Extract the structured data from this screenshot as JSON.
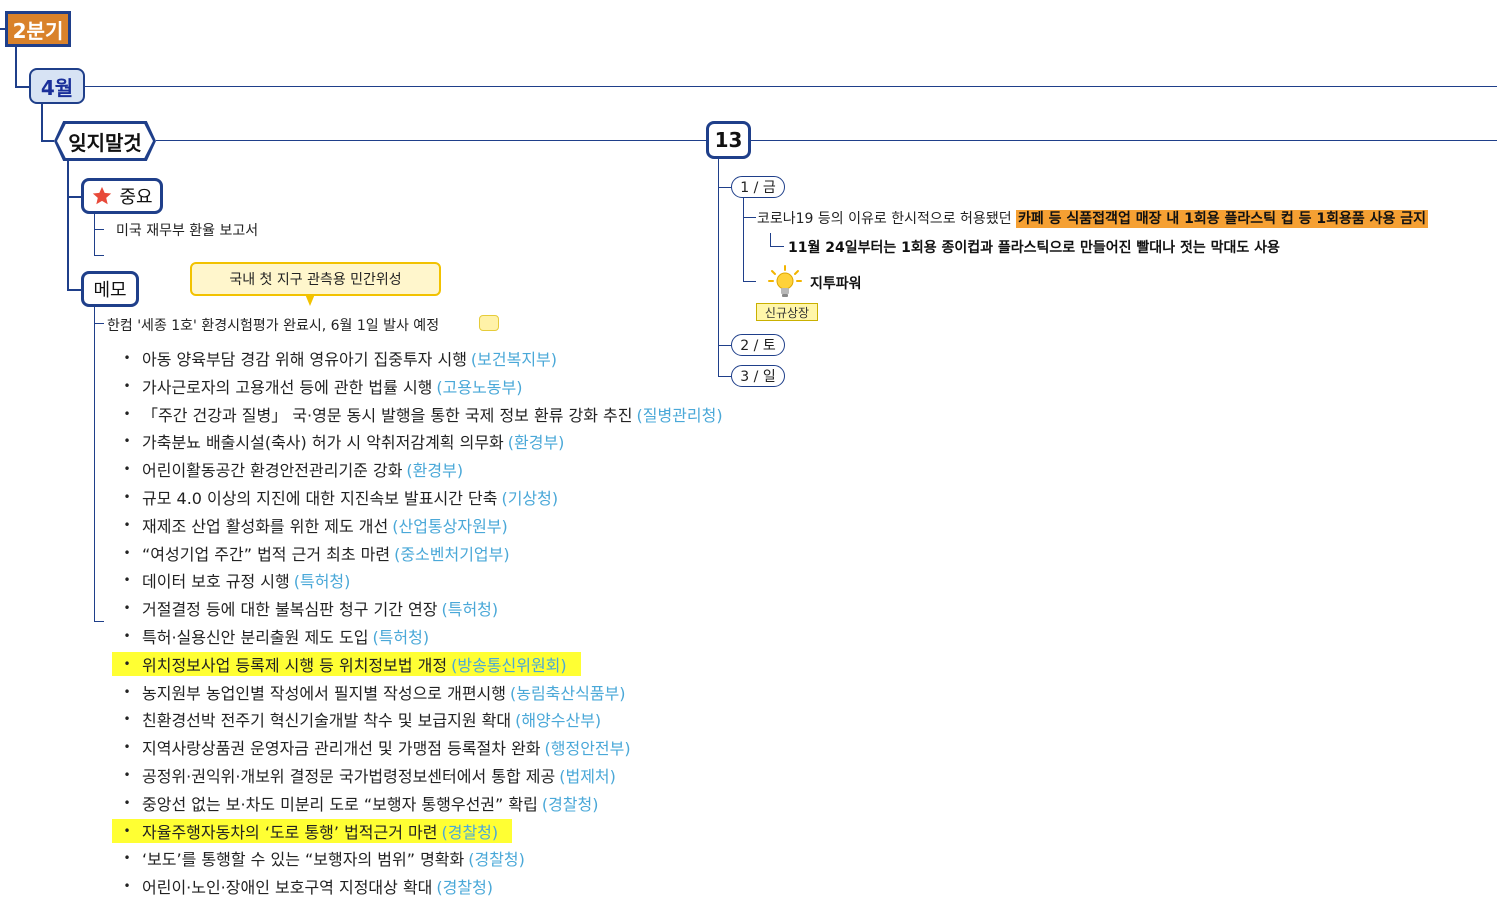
{
  "quarter": {
    "label": "2분기"
  },
  "month": {
    "label": "4월"
  },
  "reminder": {
    "label": "잊지말것"
  },
  "important": {
    "label": "중요",
    "icon": "star-icon",
    "items": [
      "미국 재무부 환율 보고서"
    ]
  },
  "memo": {
    "label": "메모",
    "callout": "국내 첫 지구 관측용 민간위성",
    "main_text": "한컴 '세종 1호'  환경시험평가  완료시, 6월 1일 발사 예정",
    "bullets": [
      {
        "text": "아동 양육부담 경감 위해 영유아기 집중투자 시행",
        "agency": "(보건복지부)",
        "highlight": false
      },
      {
        "text": "가사근로자의 고용개선 등에 관한 법률 시행",
        "agency": "(고용노동부)",
        "highlight": false
      },
      {
        "text": "「주간 건강과 질병」 국·영문 동시 발행을 통한 국제 정보 환류 강화 추진",
        "agency": "(질병관리청)",
        "highlight": false
      },
      {
        "text": "가축분뇨 배출시설(축사) 허가 시 악취저감계획 의무화",
        "agency": "(환경부)",
        "highlight": false
      },
      {
        "text": "어린이활동공간 환경안전관리기준 강화",
        "agency": "(환경부)",
        "highlight": false
      },
      {
        "text": "규모 4.0 이상의 지진에 대한 지진속보 발표시간 단축",
        "agency": "(기상청)",
        "highlight": false
      },
      {
        "text": "재제조 산업 활성화를 위한 제도 개선",
        "agency": "(산업통상자원부)",
        "highlight": false
      },
      {
        "text": "“여성기업 주간” 법적 근거 최초 마련",
        "agency": "(중소벤처기업부)",
        "highlight": false
      },
      {
        "text": "데이터 보호 규정 시행",
        "agency": "(특허청)",
        "highlight": false
      },
      {
        "text": "거절결정 등에 대한 불복심판 청구 기간 연장",
        "agency": "(특허청)",
        "highlight": false
      },
      {
        "text": "특허·실용신안 분리출원 제도 도입",
        "agency": "(특허청)",
        "highlight": false
      },
      {
        "text": "위치정보사업 등록제 시행 등 위치정보법 개정",
        "agency": "(방송통신위원회)",
        "highlight": true
      },
      {
        "text": "농지원부 농업인별 작성에서 필지별 작성으로 개편시행",
        "agency": "(농림축산식품부)",
        "highlight": false
      },
      {
        "text": "친환경선박 전주기 혁신기술개발 착수 및 보급지원 확대",
        "agency": "(해양수산부)",
        "highlight": false
      },
      {
        "text": "지역사랑상품권 운영자금 관리개선 및 가맹점 등록절차 완화",
        "agency": "(행정안전부)",
        "highlight": false
      },
      {
        "text": "공정위·권익위·개보위 결정문 국가법령정보센터에서 통합 제공",
        "agency": "(법제처)",
        "highlight": false
      },
      {
        "text": "중앙선 없는 보·차도 미분리 도로 “보행자 통행우선권” 확립",
        "agency": "(경찰청)",
        "highlight": false
      },
      {
        "text": "자율주행자동차의 ‘도로 통행’ 법적근거 마련",
        "agency": "(경찰청)",
        "highlight": true
      },
      {
        "text": "‘보도’를 통행할 수 있는 “보행자의 범위” 명확화",
        "agency": "(경찰청)",
        "highlight": false
      },
      {
        "text": "어린이·노인·장애인 보호구역 지정대상 확대",
        "agency": "(경찰청)",
        "highlight": false
      }
    ]
  },
  "week": {
    "label": "13",
    "days": [
      {
        "label": "1 / 금"
      },
      {
        "label": "2 / 토"
      },
      {
        "label": "3 / 일"
      }
    ],
    "day1": {
      "news_prefix": "코로나19 등의 이유로 한시적으로 허용됐던 ",
      "news_highlight": "카페 등 식품접객업 매장 내 1회용 플라스틱 컵 등 1회용품 사용 금지",
      "news_sub": "11월 24일부터는 1회용 종이컵과 플라스틱으로 만들어진 빨대나 젓는 막대도 사용",
      "topic": "지투파워",
      "topic_icon": "lightbulb-icon",
      "badge": "신규상장"
    }
  }
}
